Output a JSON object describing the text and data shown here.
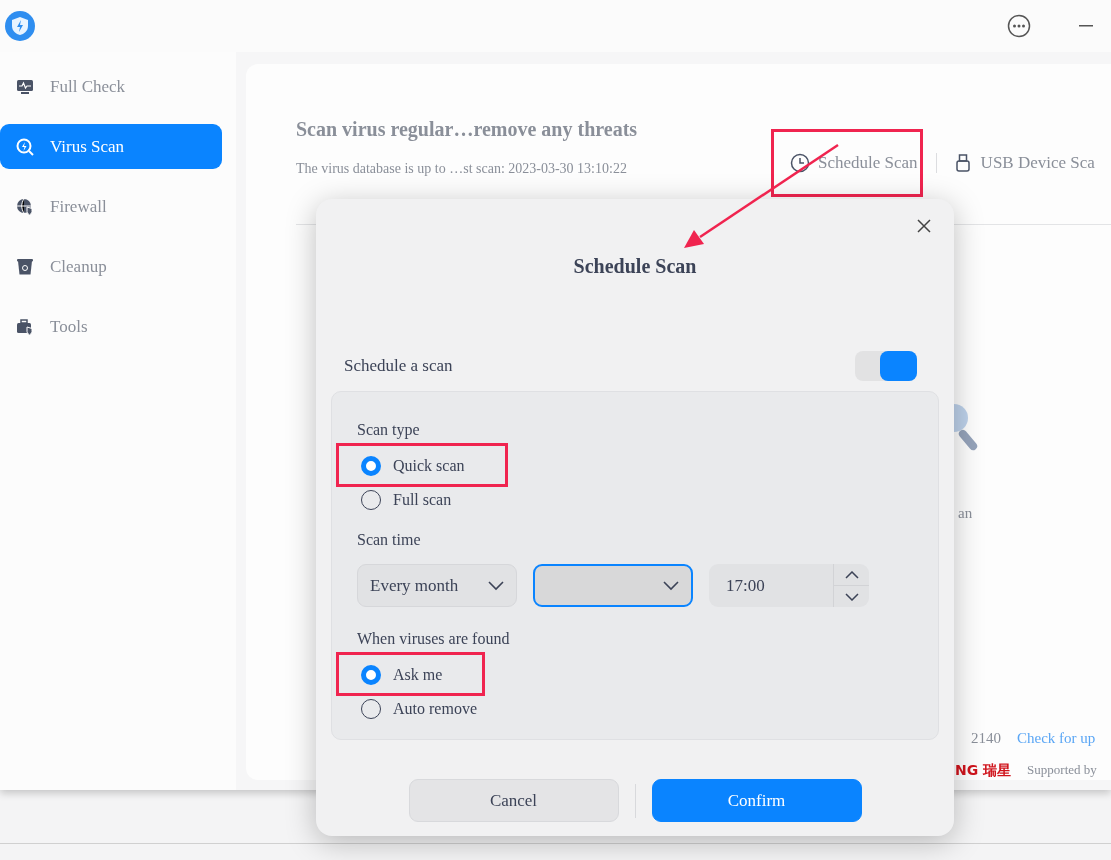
{
  "sidebar": {
    "items": [
      {
        "label": "Full Check",
        "kind": "check",
        "selected": false
      },
      {
        "label": "Virus Scan",
        "kind": "scan",
        "selected": true
      },
      {
        "label": "Firewall",
        "kind": "firewall",
        "selected": false
      },
      {
        "label": "Cleanup",
        "kind": "cleanup",
        "selected": false
      },
      {
        "label": "Tools",
        "kind": "tools",
        "selected": false
      }
    ]
  },
  "header": {
    "title": "Scan virus regular…remove any threats",
    "subtitle": "The virus database is up to …st scan: 2023-03-30 13:10:22",
    "actions": [
      {
        "label": "Schedule Scan",
        "kind": "clock",
        "highlighted": true
      },
      {
        "label": "USB Device Sca",
        "kind": "usb",
        "highlighted": false
      }
    ]
  },
  "background": {
    "caption": "an",
    "version": "2140",
    "update_link": "Check for up",
    "brand": "NG 瑞星",
    "supported_by": "Supported by"
  },
  "dialog": {
    "title": "Schedule Scan",
    "schedule": {
      "label": "Schedule a scan",
      "on": true
    },
    "scan_type": {
      "label": "Scan type",
      "options": [
        {
          "label": "Quick scan",
          "selected": true,
          "highlighted": true
        },
        {
          "label": "Full scan",
          "selected": false,
          "highlighted": false
        }
      ]
    },
    "scan_time": {
      "label": "Scan time",
      "frequency": "Every month",
      "time": "17:00"
    },
    "on_found": {
      "label": "When viruses are found",
      "options": [
        {
          "label": "Ask me",
          "selected": true,
          "highlighted": true
        },
        {
          "label": "Auto remove",
          "selected": false,
          "highlighted": false
        }
      ]
    },
    "buttons": [
      {
        "label": "Cancel",
        "kind": "secondary"
      },
      {
        "label": "Confirm",
        "kind": "primary"
      }
    ]
  }
}
